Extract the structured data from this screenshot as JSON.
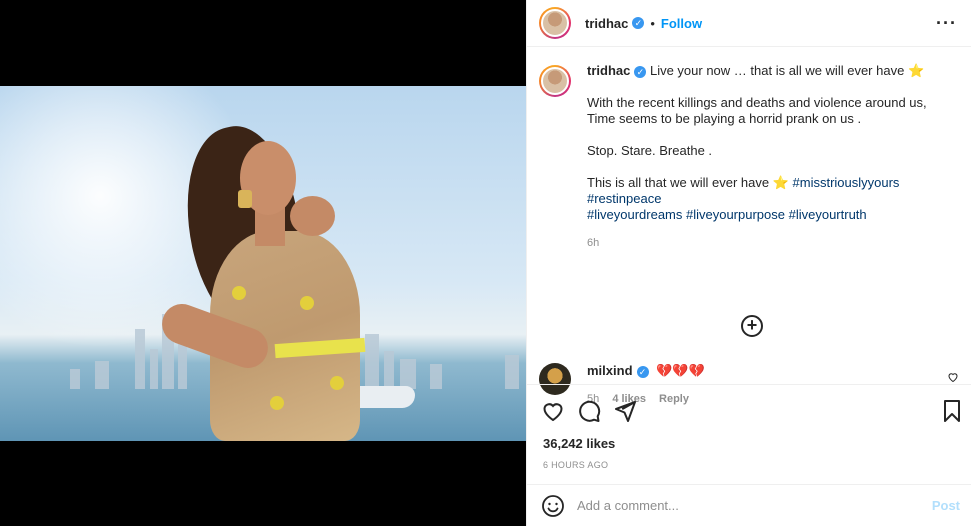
{
  "post": {
    "username": "tridhac",
    "verified": true,
    "follow_label": "Follow",
    "more_icon": "more-horizontal-icon",
    "caption": {
      "line1": "Live your now … that is all we will ever have",
      "p1": "With the recent killings and deaths and violence around us, Time seems to be playing a horrid prank on us .",
      "p2": "Stop. Stare. Breathe .",
      "p3_text": "This is all that we will ever have",
      "hashtags_line1": "#misstriouslyyours #restinpeace",
      "hashtags_line2": "#liveyourdreams #liveyourpurpose #liveyourtruth",
      "time": "6h"
    },
    "load_more_icon": "plus-circle-icon"
  },
  "comment": {
    "username": "milxind",
    "verified": true,
    "text": "💔💔💔",
    "time": "5h",
    "likes": "4 likes",
    "reply": "Reply"
  },
  "stats": {
    "likes": "36,242 likes",
    "ago": "6 HOURS AGO"
  },
  "add_comment": {
    "placeholder": "Add a comment...",
    "post_label": "Post"
  },
  "colors": {
    "link": "#0095f6",
    "hashtag": "#00376b",
    "muted": "#8e8e8e",
    "post_disabled": "#b2dffc"
  }
}
